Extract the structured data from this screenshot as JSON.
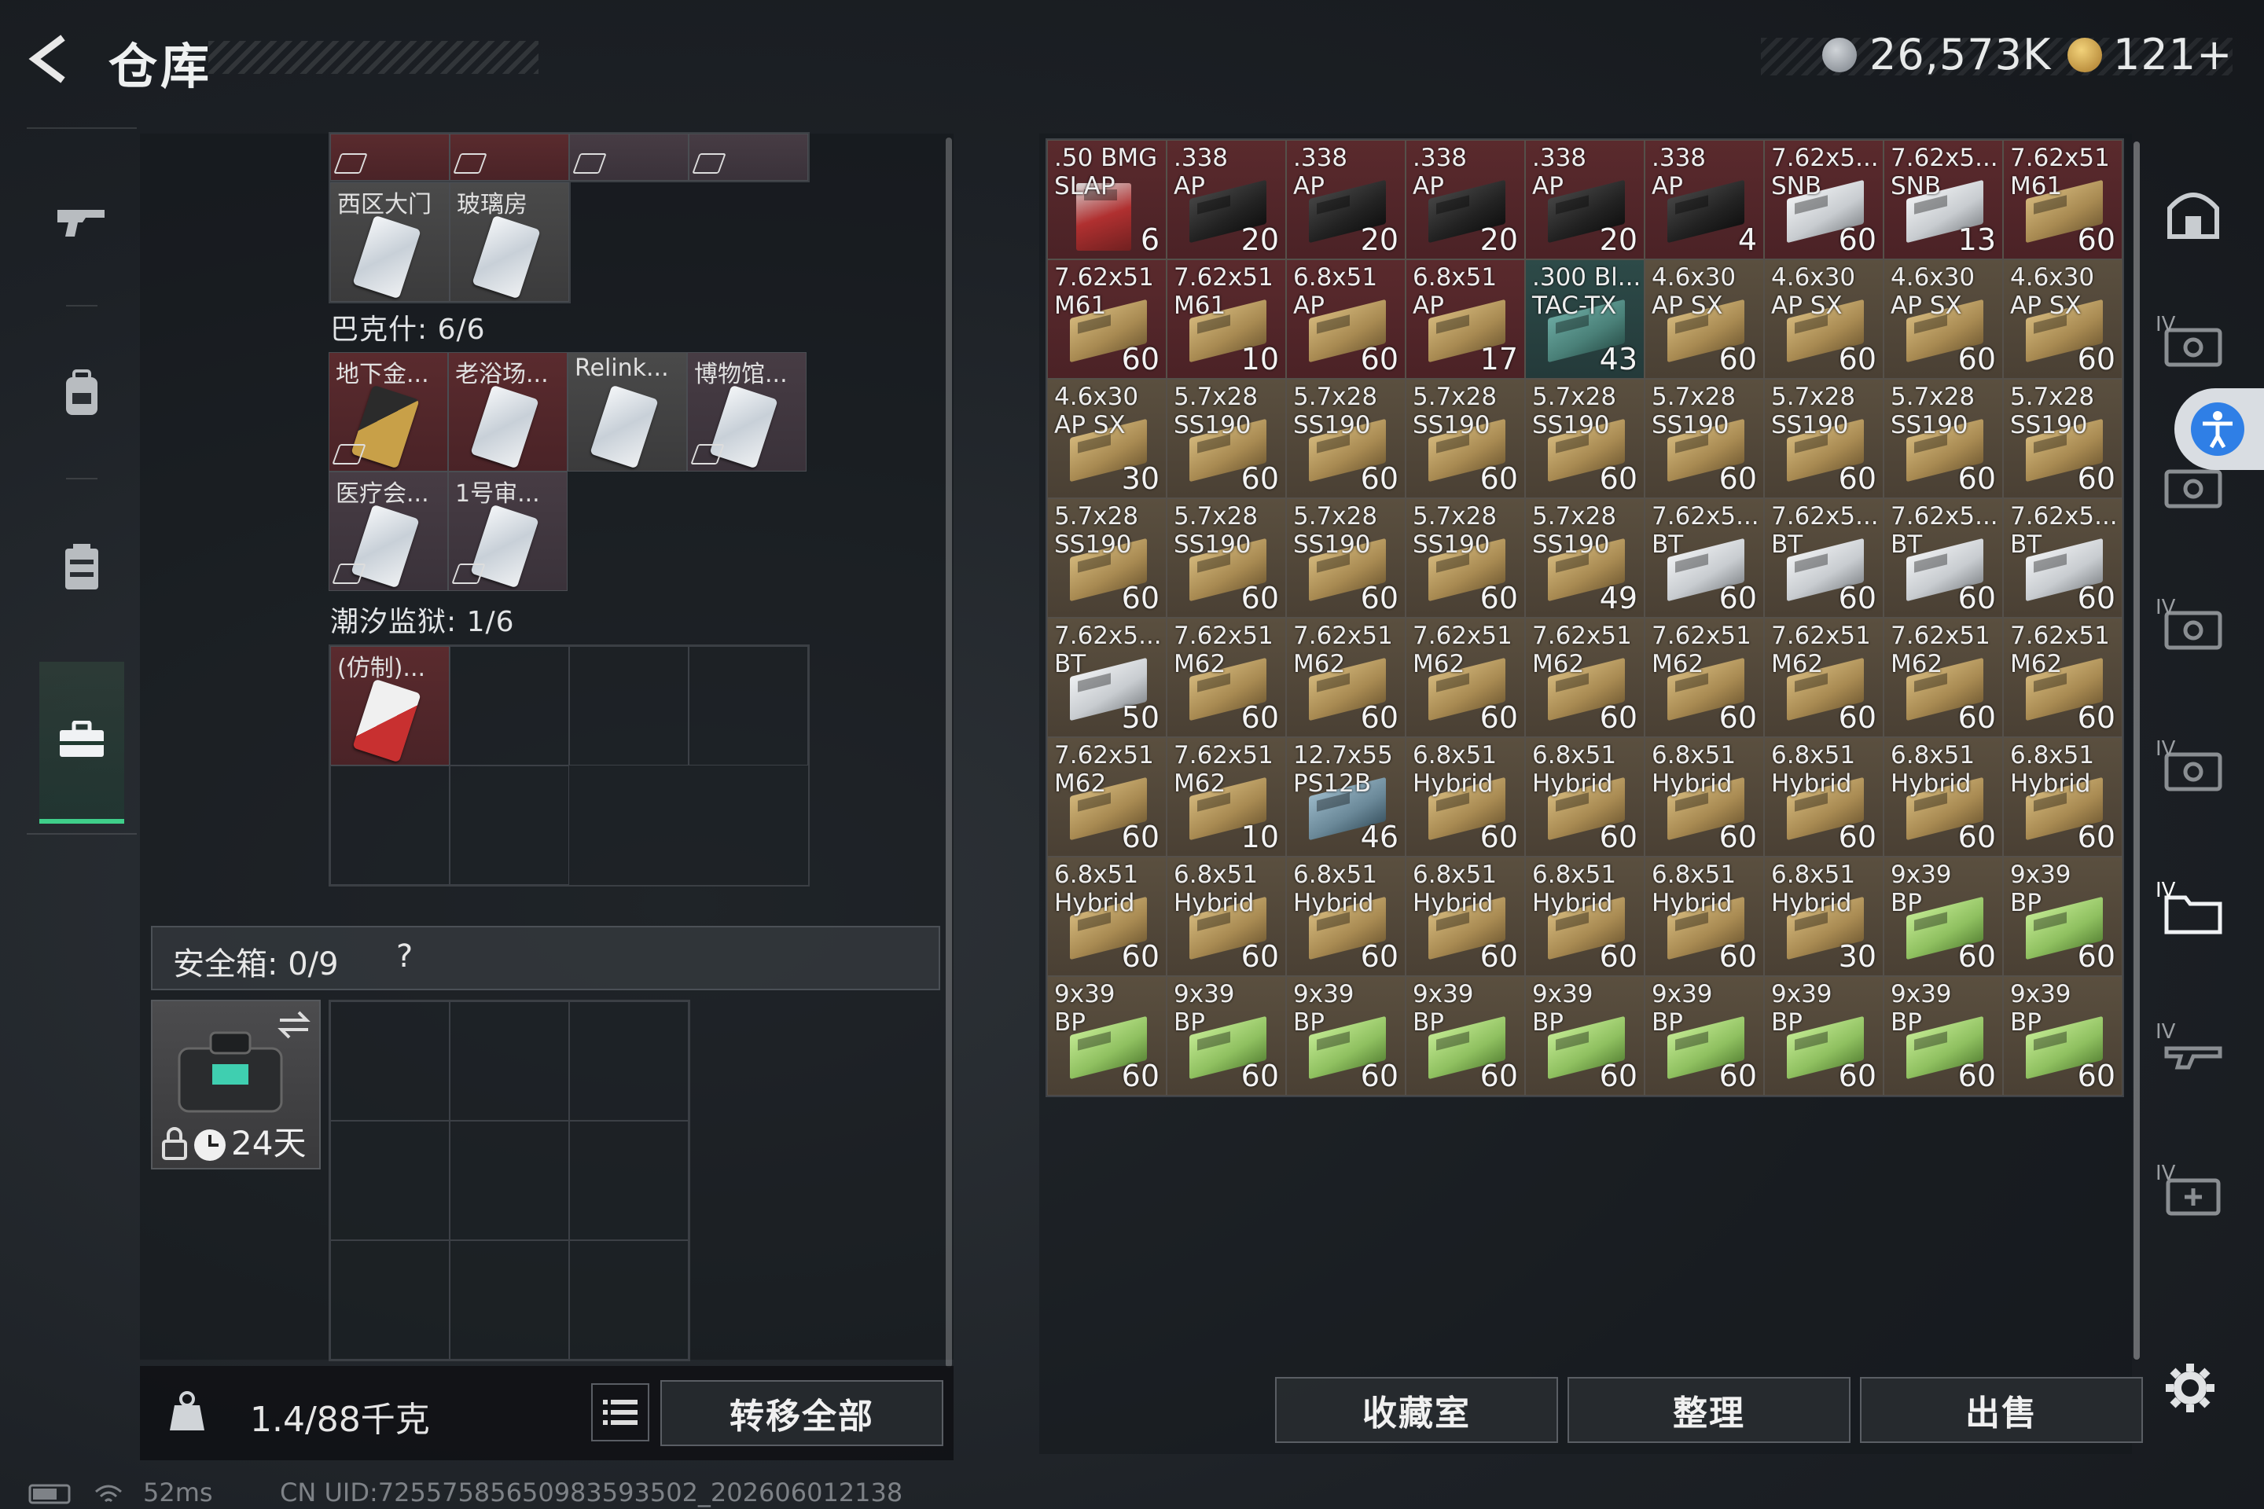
{
  "header": {
    "title": "仓库",
    "currency": {
      "silver": "26,573K",
      "gold": "121+"
    }
  },
  "container": {
    "sections": [
      {
        "top_items": [
          {
            "name": "西区大门",
            "tagged": false
          },
          {
            "name": "玻璃房",
            "tagged": false
          }
        ]
      },
      {
        "label": "巴克什: 6/6",
        "items": [
          {
            "name": "地下金...",
            "color": "red",
            "card": "gold",
            "tagged": true
          },
          {
            "name": "老浴场...",
            "color": "red",
            "card": "white",
            "tagged": false
          },
          {
            "name": "Relink...",
            "color": "gray",
            "card": "white",
            "tagged": false
          },
          {
            "name": "博物馆...",
            "color": "purple",
            "card": "white",
            "tagged": true
          },
          {
            "name": "医疗会...",
            "color": "purple",
            "card": "white",
            "tagged": true
          },
          {
            "name": "1号审...",
            "color": "purple",
            "card": "white",
            "tagged": true
          }
        ]
      },
      {
        "label": "潮汐监狱: 1/6",
        "items": [
          {
            "name": "(仿制)...",
            "color": "red",
            "card": "redcard",
            "tagged": false
          }
        ]
      }
    ]
  },
  "safe_box": {
    "label": "安全箱:  0/9",
    "help": "?",
    "item_days": "24天"
  },
  "bottom_bar": {
    "weight": "1.4/88千克",
    "transfer_all": "转移全部"
  },
  "status": {
    "ping": "52ms",
    "uid": "CN UID:7255758565098359​3502_202606012138"
  },
  "inventory": [
    {
      "name": ".50 BMG\nSLAP",
      "count": "6",
      "color": "red",
      "box": "redbox"
    },
    {
      "name": ".338\nAP",
      "count": "20",
      "color": "red",
      "box": "black"
    },
    {
      "name": ".338\nAP",
      "count": "20",
      "color": "red",
      "box": "black"
    },
    {
      "name": ".338\nAP",
      "count": "20",
      "color": "red",
      "box": "black"
    },
    {
      "name": ".338\nAP",
      "count": "20",
      "color": "red",
      "box": "black"
    },
    {
      "name": ".338\nAP",
      "count": "4",
      "color": "red",
      "box": "black"
    },
    {
      "name": "7.62x5...\nSNB",
      "count": "60",
      "color": "red",
      "box": "white"
    },
    {
      "name": "7.62x5...\nSNB",
      "count": "13",
      "color": "red",
      "box": "white"
    },
    {
      "name": "7.62x51\nM61",
      "count": "60",
      "color": "red",
      "box": "tan"
    },
    {
      "name": "7.62x51\nM61",
      "count": "60",
      "color": "red",
      "box": "tan"
    },
    {
      "name": "7.62x51\nM61",
      "count": "10",
      "color": "red",
      "box": "tan"
    },
    {
      "name": "6.8x51\nAP",
      "count": "60",
      "color": "red",
      "box": "tan"
    },
    {
      "name": "6.8x51\nAP",
      "count": "17",
      "color": "red",
      "box": "tan"
    },
    {
      "name": ".300 Bl...\nTAC-TX",
      "count": "43",
      "color": "teal",
      "box": "teal"
    },
    {
      "name": "4.6x30\nAP SX",
      "count": "60",
      "color": "gold",
      "box": "tan"
    },
    {
      "name": "4.6x30\nAP SX",
      "count": "60",
      "color": "gold",
      "box": "tan"
    },
    {
      "name": "4.6x30\nAP SX",
      "count": "60",
      "color": "gold",
      "box": "tan"
    },
    {
      "name": "4.6x30\nAP SX",
      "count": "60",
      "color": "gold",
      "box": "tan"
    },
    {
      "name": "4.6x30\nAP SX",
      "count": "30",
      "color": "gold",
      "box": "tan"
    },
    {
      "name": "5.7x28\nSS190",
      "count": "60",
      "color": "gold",
      "box": "tan"
    },
    {
      "name": "5.7x28\nSS190",
      "count": "60",
      "color": "gold",
      "box": "tan"
    },
    {
      "name": "5.7x28\nSS190",
      "count": "60",
      "color": "gold",
      "box": "tan"
    },
    {
      "name": "5.7x28\nSS190",
      "count": "60",
      "color": "gold",
      "box": "tan"
    },
    {
      "name": "5.7x28\nSS190",
      "count": "60",
      "color": "gold",
      "box": "tan"
    },
    {
      "name": "5.7x28\nSS190",
      "count": "60",
      "color": "gold",
      "box": "tan"
    },
    {
      "name": "5.7x28\nSS190",
      "count": "60",
      "color": "gold",
      "box": "tan"
    },
    {
      "name": "5.7x28\nSS190",
      "count": "60",
      "color": "gold",
      "box": "tan"
    },
    {
      "name": "5.7x28\nSS190",
      "count": "60",
      "color": "gold",
      "box": "tan"
    },
    {
      "name": "5.7x28\nSS190",
      "count": "60",
      "color": "gold",
      "box": "tan"
    },
    {
      "name": "5.7x28\nSS190",
      "count": "60",
      "color": "gold",
      "box": "tan"
    },
    {
      "name": "5.7x28\nSS190",
      "count": "60",
      "color": "gold",
      "box": "tan"
    },
    {
      "name": "5.7x28\nSS190",
      "count": "49",
      "color": "gold",
      "box": "tan"
    },
    {
      "name": "7.62x5...\nBT",
      "count": "60",
      "color": "gold",
      "box": "white"
    },
    {
      "name": "7.62x5...\nBT",
      "count": "60",
      "color": "gold",
      "box": "white"
    },
    {
      "name": "7.62x5...\nBT",
      "count": "60",
      "color": "gold",
      "box": "white"
    },
    {
      "name": "7.62x5...\nBT",
      "count": "60",
      "color": "gold",
      "box": "white"
    },
    {
      "name": "7.62x5...\nBT",
      "count": "50",
      "color": "gold",
      "box": "white"
    },
    {
      "name": "7.62x51\nM62",
      "count": "60",
      "color": "gold",
      "box": "tan"
    },
    {
      "name": "7.62x51\nM62",
      "count": "60",
      "color": "gold",
      "box": "tan"
    },
    {
      "name": "7.62x51\nM62",
      "count": "60",
      "color": "gold",
      "box": "tan"
    },
    {
      "name": "7.62x51\nM62",
      "count": "60",
      "color": "gold",
      "box": "tan"
    },
    {
      "name": "7.62x51\nM62",
      "count": "60",
      "color": "gold",
      "box": "tan"
    },
    {
      "name": "7.62x51\nM62",
      "count": "60",
      "color": "gold",
      "box": "tan"
    },
    {
      "name": "7.62x51\nM62",
      "count": "60",
      "color": "gold",
      "box": "tan"
    },
    {
      "name": "7.62x51\nM62",
      "count": "60",
      "color": "gold",
      "box": "tan"
    },
    {
      "name": "7.62x51\nM62",
      "count": "60",
      "color": "gold",
      "box": "tan"
    },
    {
      "name": "7.62x51\nM62",
      "count": "10",
      "color": "gold",
      "box": "tan"
    },
    {
      "name": "12.7x55\nPS12B",
      "count": "46",
      "color": "gold",
      "box": "blue"
    },
    {
      "name": "6.8x51\nHybrid",
      "count": "60",
      "color": "gold",
      "box": "tan"
    },
    {
      "name": "6.8x51\nHybrid",
      "count": "60",
      "color": "gold",
      "box": "tan"
    },
    {
      "name": "6.8x51\nHybrid",
      "count": "60",
      "color": "gold",
      "box": "tan"
    },
    {
      "name": "6.8x51\nHybrid",
      "count": "60",
      "color": "gold",
      "box": "tan"
    },
    {
      "name": "6.8x51\nHybrid",
      "count": "60",
      "color": "gold",
      "box": "tan"
    },
    {
      "name": "6.8x51\nHybrid",
      "count": "60",
      "color": "gold",
      "box": "tan"
    },
    {
      "name": "6.8x51\nHybrid",
      "count": "60",
      "color": "gold",
      "box": "tan"
    },
    {
      "name": "6.8x51\nHybrid",
      "count": "60",
      "color": "gold",
      "box": "tan"
    },
    {
      "name": "6.8x51\nHybrid",
      "count": "60",
      "color": "gold",
      "box": "tan"
    },
    {
      "name": "6.8x51\nHybrid",
      "count": "60",
      "color": "gold",
      "box": "tan"
    },
    {
      "name": "6.8x51\nHybrid",
      "count": "60",
      "color": "gold",
      "box": "tan"
    },
    {
      "name": "6.8x51\nHybrid",
      "count": "60",
      "color": "gold",
      "box": "tan"
    },
    {
      "name": "6.8x51\nHybrid",
      "count": "30",
      "color": "gold",
      "box": "tan"
    },
    {
      "name": "9x39\nBP",
      "count": "60",
      "color": "gold",
      "box": "green"
    },
    {
      "name": "9x39\nBP",
      "count": "60",
      "color": "gold",
      "box": "green"
    },
    {
      "name": "9x39\nBP",
      "count": "60",
      "color": "gold",
      "box": "green"
    },
    {
      "name": "9x39\nBP",
      "count": "60",
      "color": "gold",
      "box": "green"
    },
    {
      "name": "9x39\nBP",
      "count": "60",
      "color": "gold",
      "box": "green"
    },
    {
      "name": "9x39\nBP",
      "count": "60",
      "color": "gold",
      "box": "green"
    },
    {
      "name": "9x39\nBP",
      "count": "60",
      "color": "gold",
      "box": "green"
    },
    {
      "name": "9x39\nBP",
      "count": "60",
      "color": "gold",
      "box": "green"
    },
    {
      "name": "9x39\nBP",
      "count": "60",
      "color": "gold",
      "box": "green"
    },
    {
      "name": "9x39\nBP",
      "count": "60",
      "color": "gold",
      "box": "green"
    },
    {
      "name": "9x39\nBP",
      "count": "60",
      "color": "gold",
      "box": "green"
    }
  ],
  "actions": {
    "collection": "收藏室",
    "organize": "整理",
    "sell": "出售"
  },
  "right_nav": {
    "tier_label": "IV"
  },
  "colors": {
    "accent": "#3fcf8a",
    "rarity_red": "#5a2a2d",
    "rarity_gold": "#5a4f3f",
    "rarity_teal": "#2d4a48"
  }
}
